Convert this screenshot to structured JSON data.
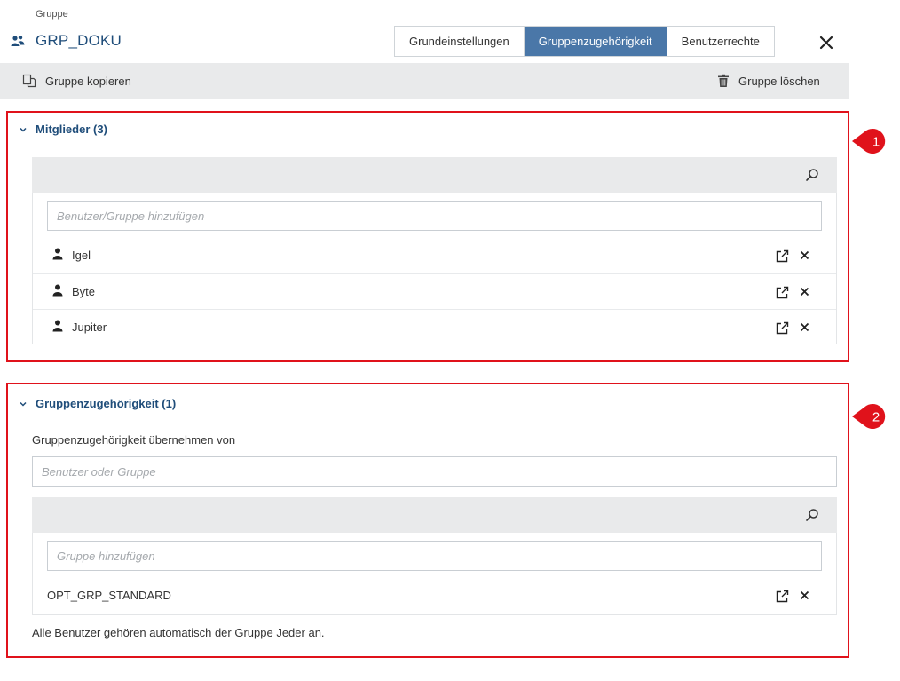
{
  "breadcrumb": "Gruppe",
  "header": {
    "title": "GRP_DOKU",
    "tabs": [
      {
        "label": "Grundeinstellungen",
        "active": false
      },
      {
        "label": "Gruppenzugehörigkeit",
        "active": true
      },
      {
        "label": "Benutzerrechte",
        "active": false
      }
    ]
  },
  "toolbar": {
    "copy_label": "Gruppe kopieren",
    "delete_label": "Gruppe löschen"
  },
  "members": {
    "title": "Mitglieder (3)",
    "badge": "1",
    "add_placeholder": "Benutzer/Gruppe hinzufügen",
    "items": [
      {
        "name": "Igel"
      },
      {
        "name": "Byte"
      },
      {
        "name": "Jupiter"
      }
    ]
  },
  "membership": {
    "title": "Gruppenzugehörigkeit (1)",
    "badge": "2",
    "inherit_label": "Gruppenzugehörigkeit übernehmen von",
    "inherit_placeholder": "Benutzer oder Gruppe",
    "add_placeholder": "Gruppe hinzufügen",
    "items": [
      {
        "name": "OPT_GRP_STANDARD"
      }
    ],
    "note": "Alle Benutzer gehören automatisch der Gruppe Jeder an."
  },
  "colors": {
    "accent": "#4a77a8",
    "title": "#1f4d7a",
    "highlight_border": "#e0121b"
  }
}
